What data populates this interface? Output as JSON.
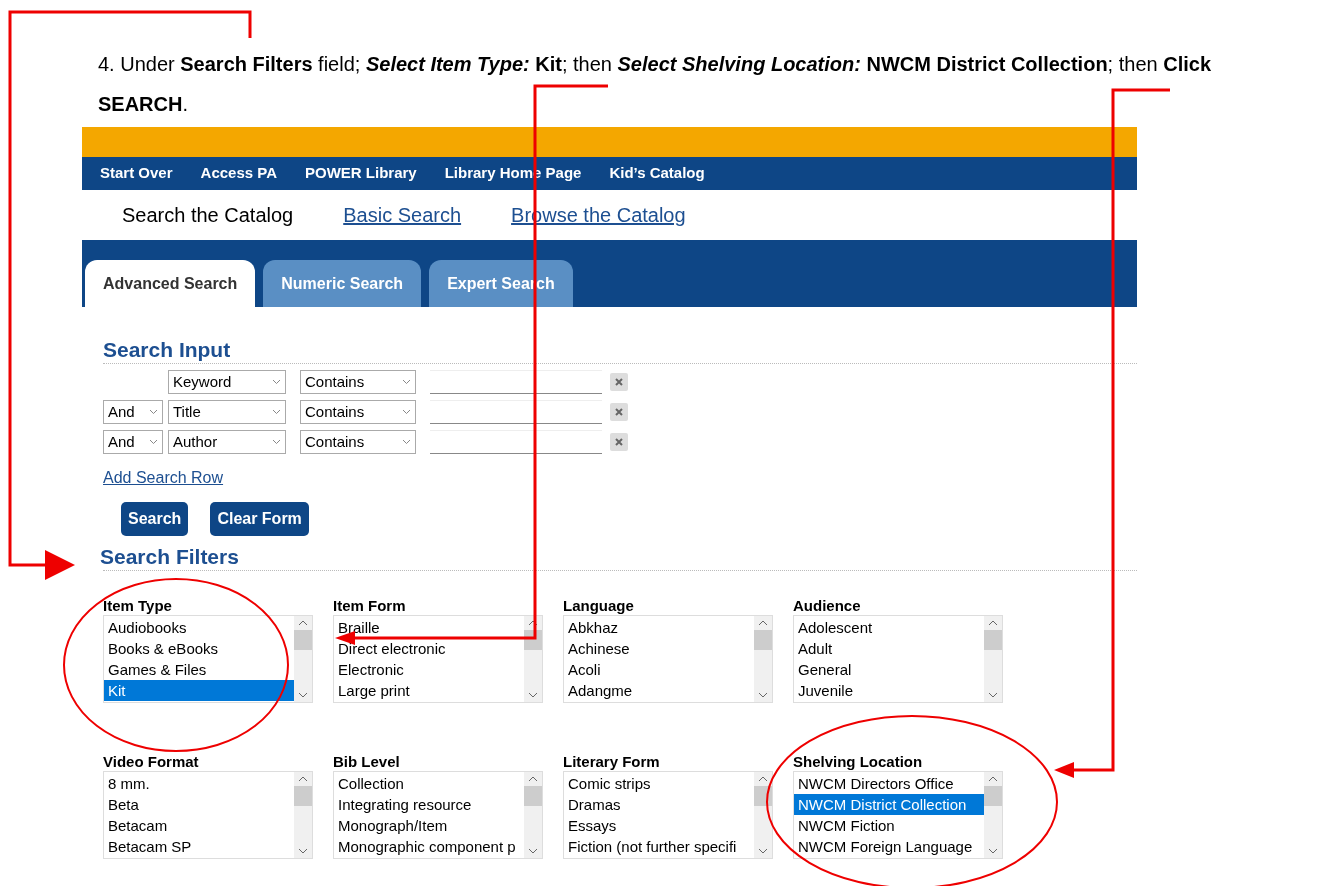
{
  "instruction": "4.  Under **Search Filters** field; *Select Item Type:* **Kit**; then *Select Shelving Location:* **NWCM District Collection**; then **Click SEARCH**.",
  "nav": [
    "Start Over",
    "Access PA",
    "POWER Library",
    "Library Home Page",
    "Kid’s Catalog"
  ],
  "subnav": {
    "title": "Search the Catalog",
    "links": [
      "Basic Search",
      "Browse the Catalog"
    ]
  },
  "tabs": [
    {
      "label": "Advanced Search",
      "selected": true
    },
    {
      "label": "Numeric Search",
      "selected": false
    },
    {
      "label": "Expert Search",
      "selected": false
    }
  ],
  "search_input": {
    "heading": "Search Input",
    "rows": [
      {
        "bool": null,
        "field": "Keyword",
        "op": "Contains"
      },
      {
        "bool": "And",
        "field": "Title",
        "op": "Contains"
      },
      {
        "bool": "And",
        "field": "Author",
        "op": "Contains"
      }
    ],
    "add_row": "Add Search Row",
    "buttons": [
      "Search",
      "Clear Form"
    ]
  },
  "search_filters": {
    "heading": "Search Filters",
    "filters": [
      {
        "label": "Item Type",
        "options": [
          {
            "text": "Audiobooks",
            "selected": false
          },
          {
            "text": "Books & eBooks",
            "selected": false
          },
          {
            "text": "Games & Files",
            "selected": false
          },
          {
            "text": "Kit",
            "selected": true
          }
        ]
      },
      {
        "label": "Item Form",
        "options": [
          {
            "text": "Braille",
            "selected": false
          },
          {
            "text": "Direct electronic",
            "selected": false
          },
          {
            "text": "Electronic",
            "selected": false
          },
          {
            "text": "Large print",
            "selected": false
          }
        ]
      },
      {
        "label": "Language",
        "options": [
          {
            "text": "Abkhaz",
            "selected": false
          },
          {
            "text": "Achinese",
            "selected": false
          },
          {
            "text": "Acoli",
            "selected": false
          },
          {
            "text": "Adangme",
            "selected": false
          }
        ]
      },
      {
        "label": "Audience",
        "options": [
          {
            "text": "Adolescent",
            "selected": false
          },
          {
            "text": "Adult",
            "selected": false
          },
          {
            "text": "General",
            "selected": false
          },
          {
            "text": "Juvenile",
            "selected": false
          }
        ]
      },
      {
        "label": "Video Format",
        "options": [
          {
            "text": "8 mm.",
            "selected": false
          },
          {
            "text": "Beta",
            "selected": false
          },
          {
            "text": "Betacam",
            "selected": false
          },
          {
            "text": "Betacam SP",
            "selected": false
          }
        ]
      },
      {
        "label": "Bib Level",
        "options": [
          {
            "text": "Collection",
            "selected": false
          },
          {
            "text": "Integrating resource",
            "selected": false
          },
          {
            "text": "Monograph/Item",
            "selected": false
          },
          {
            "text": "Monographic component p",
            "selected": false
          }
        ]
      },
      {
        "label": "Literary Form",
        "options": [
          {
            "text": "Comic strips",
            "selected": false
          },
          {
            "text": "Dramas",
            "selected": false
          },
          {
            "text": "Essays",
            "selected": false
          },
          {
            "text": "Fiction (not further specifi",
            "selected": false
          }
        ]
      },
      {
        "label": "Shelving Location",
        "options": [
          {
            "text": "NWCM Directors Office",
            "selected": false
          },
          {
            "text": "NWCM District Collection",
            "selected": true
          },
          {
            "text": "NWCM Fiction",
            "selected": false
          },
          {
            "text": "NWCM Foreign Language",
            "selected": false
          }
        ]
      }
    ]
  }
}
